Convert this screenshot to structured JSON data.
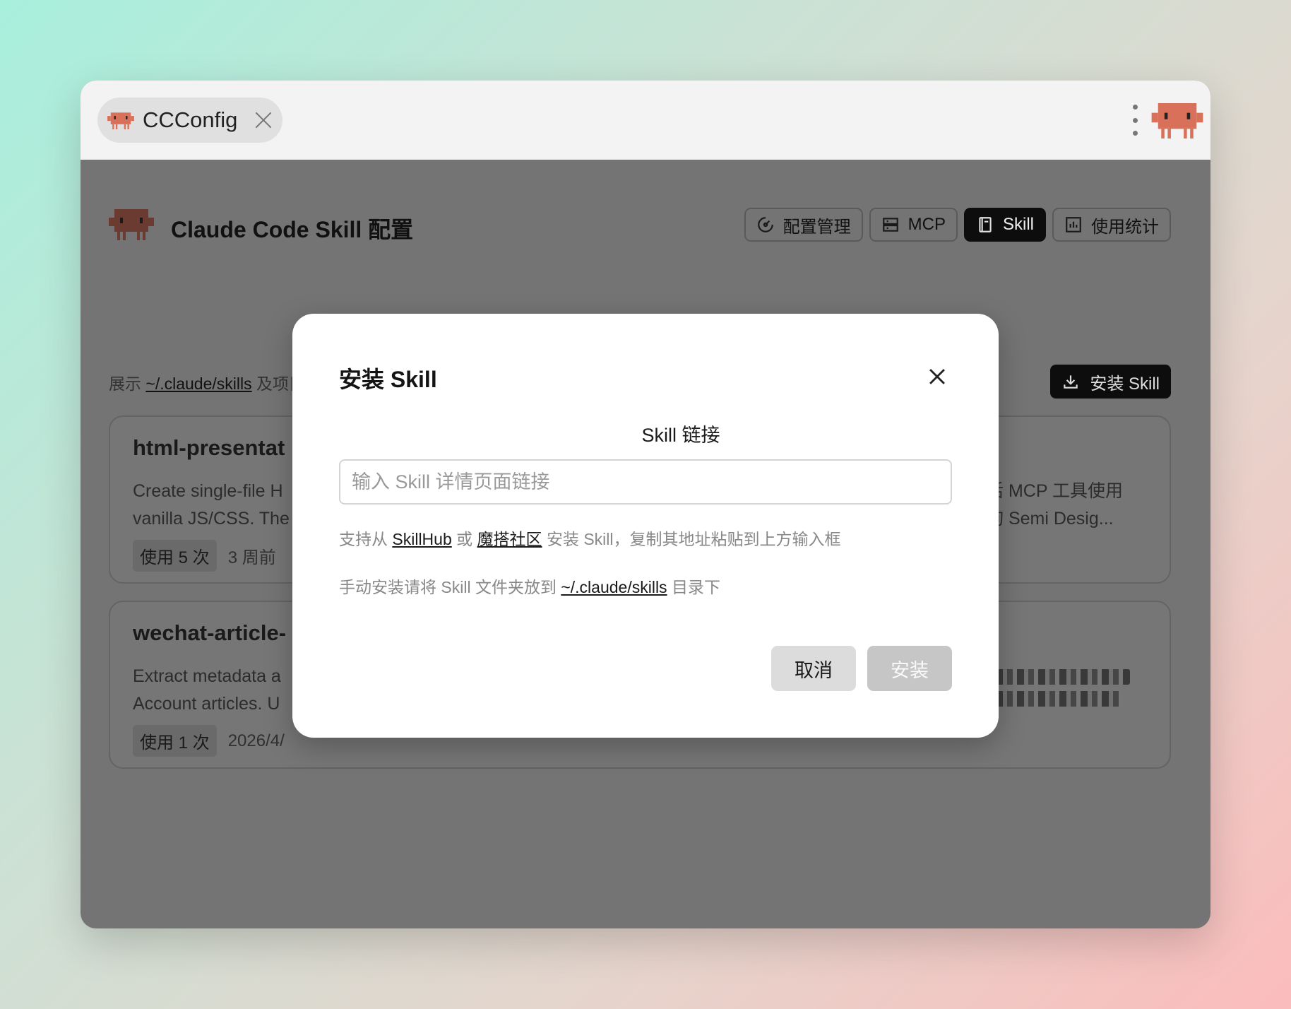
{
  "tab": {
    "label": "CCConfig"
  },
  "app": {
    "title": "Claude Code Skill 配置"
  },
  "nav": {
    "items": [
      {
        "label": "配置管理"
      },
      {
        "label": "MCP"
      },
      {
        "label": "Skill"
      },
      {
        "label": "使用统计"
      }
    ],
    "active": "Skill"
  },
  "subtitle": {
    "prefix": "展示",
    "path": "~/.claude/skills",
    "suffix": "及项目目录下的 SKILL"
  },
  "install_button_label": "安装 Skill",
  "skills": [
    {
      "name": "html-presentat",
      "desc_lines": [
        "Create single-file H",
        "vanilla JS/CSS. The"
      ],
      "usage": "使用 5 次",
      "time": "3 周前",
      "right_desc_lines": [
        "活 MCP 工具使用",
        "询 Semi Desig..."
      ],
      "enabled": false
    },
    {
      "name": "wechat-article-",
      "desc_lines": [
        "Extract metadata a",
        "Account articles. U"
      ],
      "usage": "使用 1 次",
      "time": "2026/4/",
      "enabled": true
    }
  ],
  "modal": {
    "title": "安装 Skill",
    "field_label": "Skill 链接",
    "input_placeholder": "输入 Skill 详情页面链接",
    "input_value": "",
    "hint1": {
      "prefix": "支持从",
      "link1": "SkillHub",
      "mid": "或",
      "link2": "魔搭社区",
      "suffix": "安装 Skill，复制其地址粘贴到上方输入框"
    },
    "hint2": {
      "prefix": "手动安装请将 Skill 文件夹放到",
      "path": "~/.claude/skills",
      "suffix": "目录下"
    },
    "cancel_label": "取消",
    "confirm_label": "安装"
  },
  "colors": {
    "accent_logo": "#d9715a",
    "overlay": "#747474",
    "toggle_on": "#0e5c2c"
  }
}
